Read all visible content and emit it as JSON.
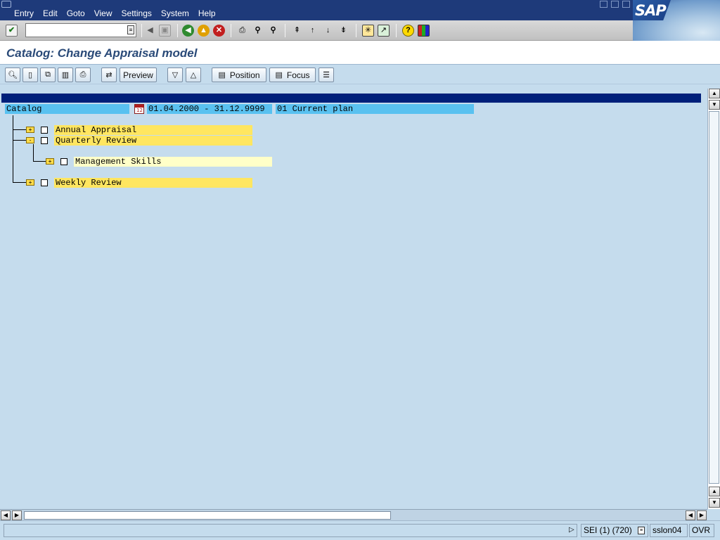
{
  "menubar": {
    "items": [
      {
        "label": "Entry"
      },
      {
        "label": "Edit"
      },
      {
        "label": "Goto"
      },
      {
        "label": "View"
      },
      {
        "label": "Settings"
      },
      {
        "label": "System"
      },
      {
        "label": "Help"
      }
    ],
    "logo_text": "SAP"
  },
  "command_field": {
    "value": ""
  },
  "title": "Catalog: Change Appraisal model",
  "app_toolbar": {
    "preview_label": "Preview",
    "position_label": "Position",
    "focus_label": "Focus"
  },
  "tree": {
    "header": {
      "col1": "Catalog",
      "date_range": "01.04.2000 - 31.12.9999",
      "plan": "01 Current plan",
      "calendar_icon_text": "12"
    },
    "nodes": [
      {
        "label": "Annual Appraisal",
        "expander": "+"
      },
      {
        "label": "Quarterly Review",
        "expander": "-"
      },
      {
        "label": "Management Skills",
        "expander": "+"
      },
      {
        "label": "Weekly Review",
        "expander": "+"
      }
    ]
  },
  "status": {
    "session": "SEI (1) (720)",
    "server": "sslon04",
    "mode": "OVR"
  },
  "colors": {
    "menubar": "#1e3a7a",
    "background": "#c5dced",
    "header_bar": "#00207a",
    "cell_blue": "#59c1f0",
    "cell_yellow": "#ffe660",
    "cell_light_yellow": "#ffffc8"
  }
}
